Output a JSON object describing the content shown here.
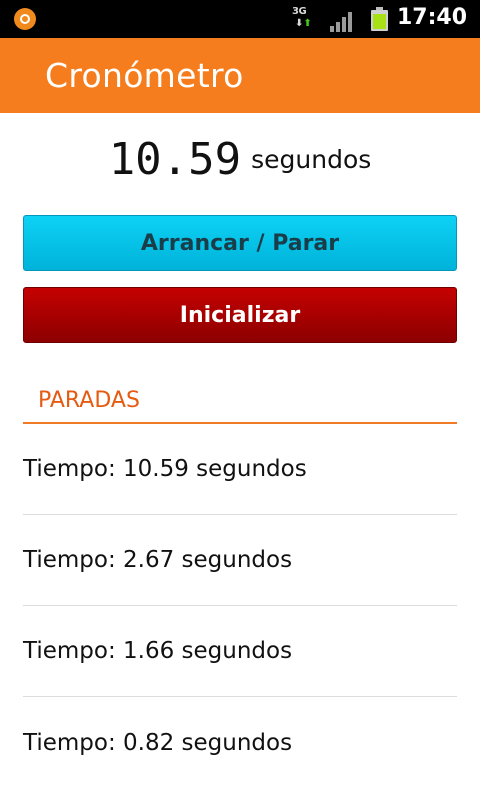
{
  "status_bar": {
    "network_label": "3G",
    "clock": "17:40",
    "colors": {
      "background": "#000000",
      "battery_fill": "#a8e017",
      "left_icon": "#f08a1d"
    }
  },
  "app_bar": {
    "title": "Cronómetro",
    "color": "#f57d1d"
  },
  "timer": {
    "value": "10.59",
    "unit": "segundos"
  },
  "buttons": {
    "start_stop": "Arrancar / Parar",
    "reset": "Inicializar",
    "colors": {
      "start_stop": "#00c3e8",
      "reset": "#b00000"
    }
  },
  "laps": {
    "header": "PARADAS",
    "accent": "#e55b11",
    "items": [
      "Tiempo: 10.59 segundos",
      "Tiempo: 2.67 segundos",
      "Tiempo: 1.66 segundos",
      "Tiempo: 0.82 segundos"
    ]
  }
}
